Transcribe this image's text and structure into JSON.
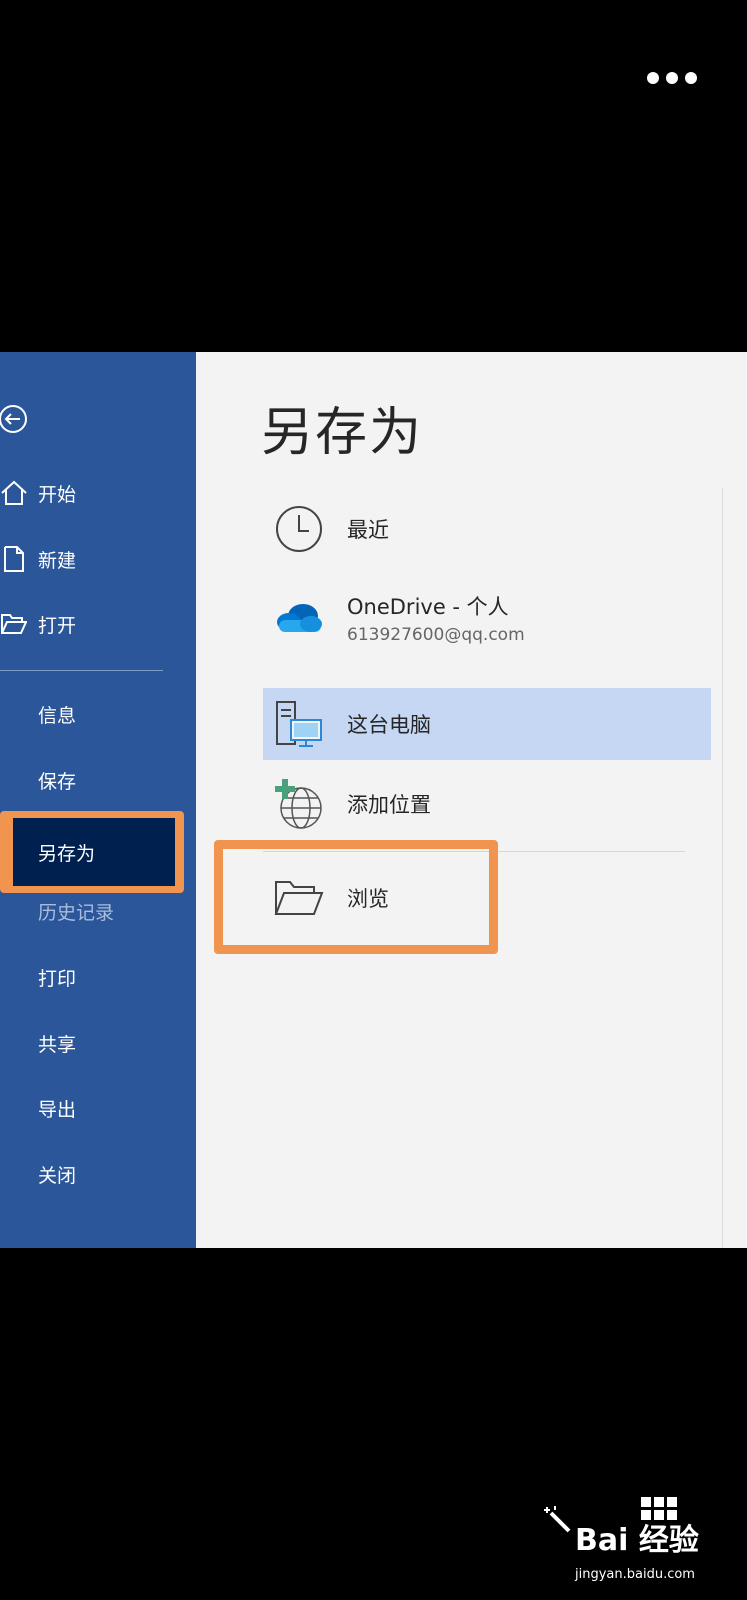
{
  "header": {
    "more_icon": "more-horizontal-icon"
  },
  "sidebar": {
    "back_icon": "back-arrow-icon",
    "items": [
      {
        "label": "开始",
        "icon": "home-icon"
      },
      {
        "label": "新建",
        "icon": "new-document-icon"
      },
      {
        "label": "打开",
        "icon": "open-folder-icon"
      },
      {
        "label": "信息"
      },
      {
        "label": "保存"
      },
      {
        "label": "另存为",
        "selected": true
      },
      {
        "label": "历史记录",
        "disabled": true
      },
      {
        "label": "打印"
      },
      {
        "label": "共享"
      },
      {
        "label": "导出"
      },
      {
        "label": "关闭"
      }
    ],
    "colors": {
      "background": "#2b579a",
      "selected": "#002050",
      "highlight": "#f0944f"
    }
  },
  "main": {
    "title": "另存为",
    "locations": [
      {
        "label": "最近",
        "icon": "clock-icon"
      },
      {
        "label": "OneDrive - 个人",
        "sub": "613927600@qq.com",
        "icon": "onedrive-cloud-icon"
      },
      {
        "label": "这台电脑",
        "icon": "this-pc-icon",
        "selected": true
      },
      {
        "label": "添加位置",
        "icon": "add-location-globe-icon"
      },
      {
        "label": "浏览",
        "icon": "browse-folder-icon"
      }
    ]
  },
  "watermark": {
    "logo": "Bai 经验",
    "url": "jingyan.baidu.com"
  }
}
